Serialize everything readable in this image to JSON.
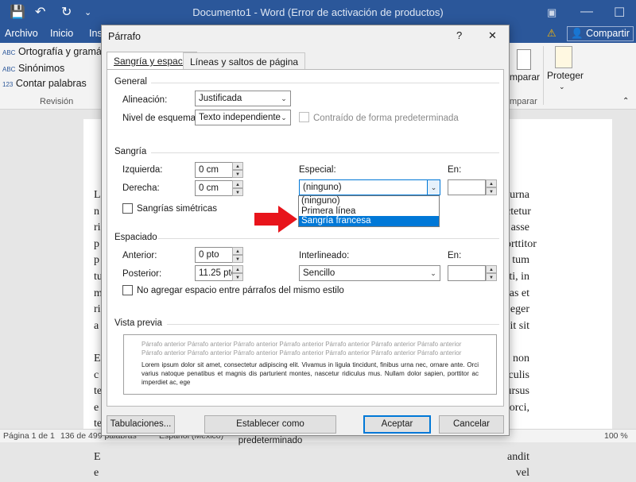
{
  "window": {
    "title": "Documento1 - Word (Error de activación de productos)"
  },
  "ribbon": {
    "tabs": [
      "Archivo",
      "Inicio",
      "Ins"
    ],
    "share_label": "Compartir",
    "review_items": [
      "Ortografía y gramátic",
      "Sinónimos",
      "Contar palabras"
    ],
    "review_group": "Revisión",
    "compare_label": "mparar",
    "compare_group": "mparar",
    "protect_label": "Proteger"
  },
  "document": {
    "left_letters": [
      "L",
      "n",
      "ri",
      "p",
      "p",
      "tu",
      "m",
      "ri",
      "a",
      "",
      "E",
      "c",
      "te",
      "e",
      "te",
      "",
      "E",
      "e"
    ],
    "right_fragments": [
      "urna",
      "ctetur",
      "asse",
      "orttitor",
      "tum",
      "tti, in",
      "as et",
      "eger",
      "sit sit",
      "",
      "non",
      "culis",
      "ursus",
      "orci,",
      "",
      "",
      "andit",
      "vel"
    ]
  },
  "statusbar": {
    "page": "Página 1 de 1",
    "words": "136 de 499 palabras",
    "lang": "Español (México)",
    "zoom": "100 %"
  },
  "dialog": {
    "title": "Párrafo",
    "help": "?",
    "close": "✕",
    "tabs": [
      "Sangría y espacio",
      "Líneas y saltos de página"
    ],
    "general": {
      "title": "General",
      "alignment_label": "Alineación:",
      "alignment_value": "Justificada",
      "outline_label": "Nivel de esquema:",
      "outline_value": "Texto independiente",
      "collapsed_label": "Contraído de forma predeterminada"
    },
    "indent": {
      "title": "Sangría",
      "left_label": "Izquierda:",
      "left_value": "0 cm",
      "right_label": "Derecha:",
      "right_value": "0 cm",
      "mirror_label": "Sangrías simétricas",
      "special_label": "Especial:",
      "special_value": "(ninguno)",
      "by_label": "En:",
      "by_value": "",
      "special_options": [
        "(ninguno)",
        "Primera línea",
        "Sangría francesa"
      ],
      "selected_option": "Sangría francesa"
    },
    "spacing": {
      "title": "Espaciado",
      "before_label": "Anterior:",
      "before_value": "0 pto",
      "after_label": "Posterior:",
      "after_value": "11.25 pto",
      "line_label": "Interlineado:",
      "line_value": "Sencillo",
      "at_label": "En:",
      "at_value": "",
      "no_space_label": "No agregar espacio entre párrafos del mismo estilo"
    },
    "preview": {
      "title": "Vista previa",
      "prev_text": "Párrafo anterior Párrafo anterior Párrafo anterior Párrafo anterior Párrafo anterior Párrafo anterior Párrafo anterior Párrafo anterior Párrafo anterior Párrafo anterior Párrafo anterior Párrafo anterior Párrafo anterior Párrafo anterior Párrafo anterior",
      "sample_text": "Lorem ipsum dolor sit amet, consectetur adipiscing elit. Vivamus in ligula tincidunt, finibus urna nec, ornare ante. Orci varius natoque penatibus et magnis dis parturient montes, nascetur ridiculus mus. Nullam dolor sapien, porttitor ac imperdiet ac, ege"
    },
    "buttons": {
      "tabs": "Tabulaciones...",
      "default": "Establecer como predeterminado",
      "ok": "Aceptar",
      "cancel": "Cancelar"
    }
  },
  "annotation": {
    "arrow_color": "#e8141b"
  }
}
